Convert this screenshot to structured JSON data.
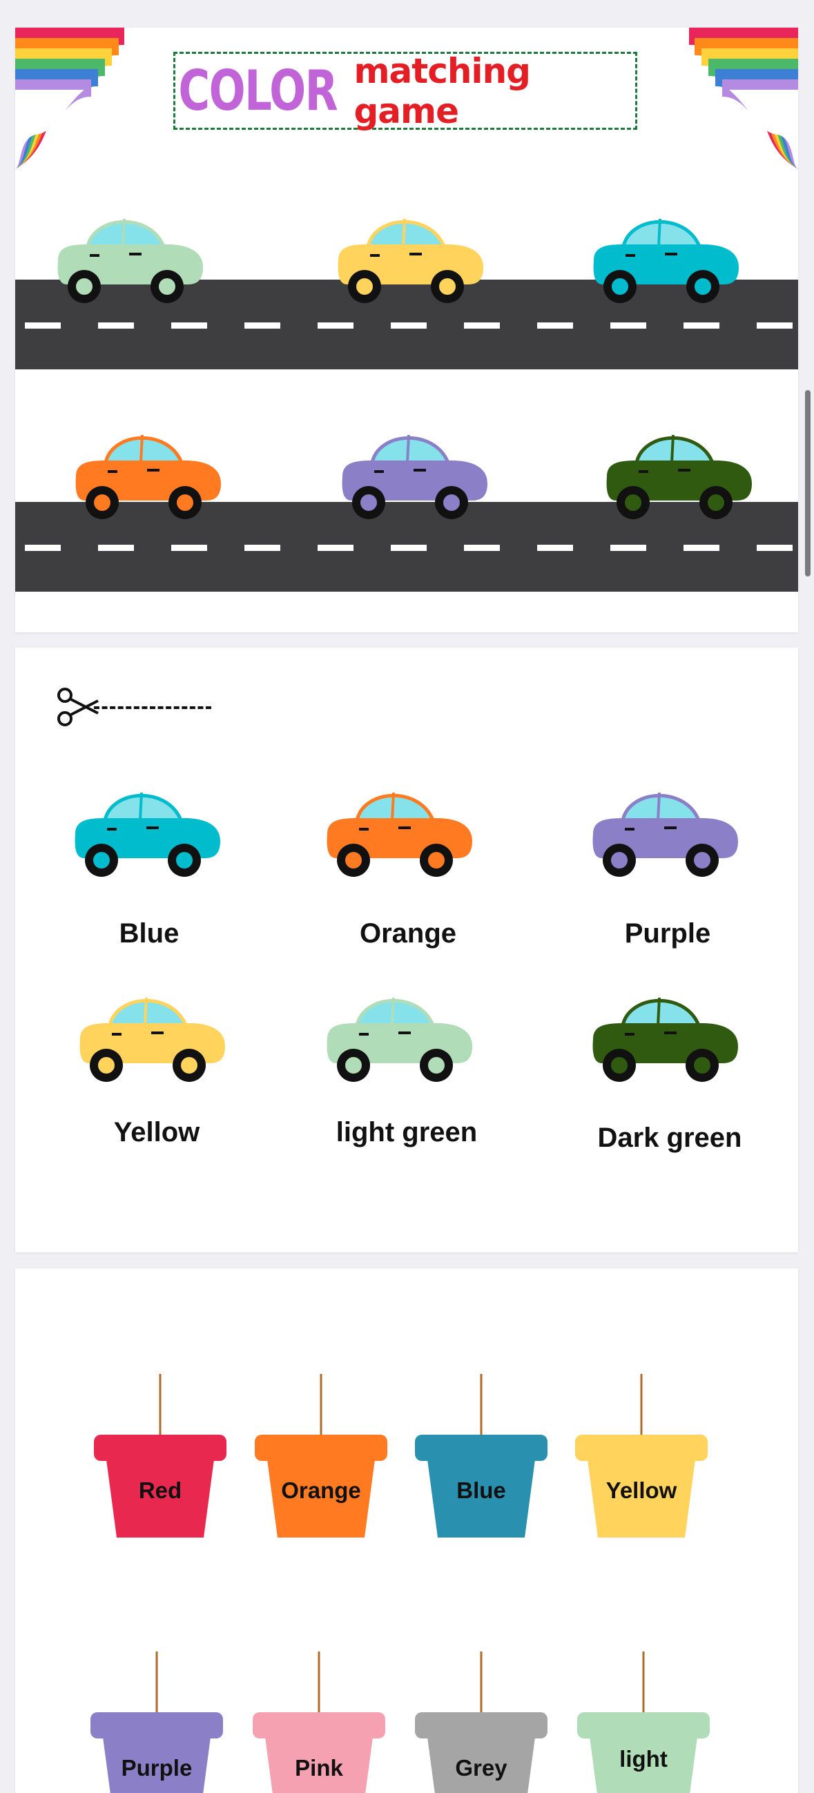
{
  "header": {
    "title_color_word": "COLOR",
    "title_rest": "matching game"
  },
  "cut_section": {
    "cars": [
      {
        "label": "Blue",
        "color": "#00bccd"
      },
      {
        "label": "Orange",
        "color": "#ff7a20"
      },
      {
        "label": "Purple",
        "color": "#8b80c8"
      },
      {
        "label": "Yellow",
        "color": "#ffd35c"
      },
      {
        "label": "light green",
        "color": "#b1dcb8"
      },
      {
        "label": "Dark green",
        "color": "#2f5a10"
      }
    ]
  },
  "road_cars": [
    {
      "color": "#b1dcb8",
      "road": 1
    },
    {
      "color": "#ffd35c",
      "road": 1
    },
    {
      "color": "#00bccd",
      "road": 1
    },
    {
      "color": "#ff7a20",
      "road": 2
    },
    {
      "color": "#8b80c8",
      "road": 2
    },
    {
      "color": "#2f5a10",
      "road": 2
    }
  ],
  "pots": [
    {
      "label": "Red",
      "color": "#e8284e"
    },
    {
      "label": "Orange",
      "color": "#ff7a20"
    },
    {
      "label": "Blue",
      "color": "#2a90b0"
    },
    {
      "label": "Yellow",
      "color": "#ffd35c"
    },
    {
      "label": "Purple",
      "color": "#8b80c8"
    },
    {
      "label": "Pink",
      "color": "#f6a1b1"
    },
    {
      "label": "Grey",
      "color": "#a5a5a5"
    },
    {
      "label": "light",
      "color": "#b1dcb8"
    }
  ],
  "icons": {
    "scissors": "scissors-icon"
  }
}
